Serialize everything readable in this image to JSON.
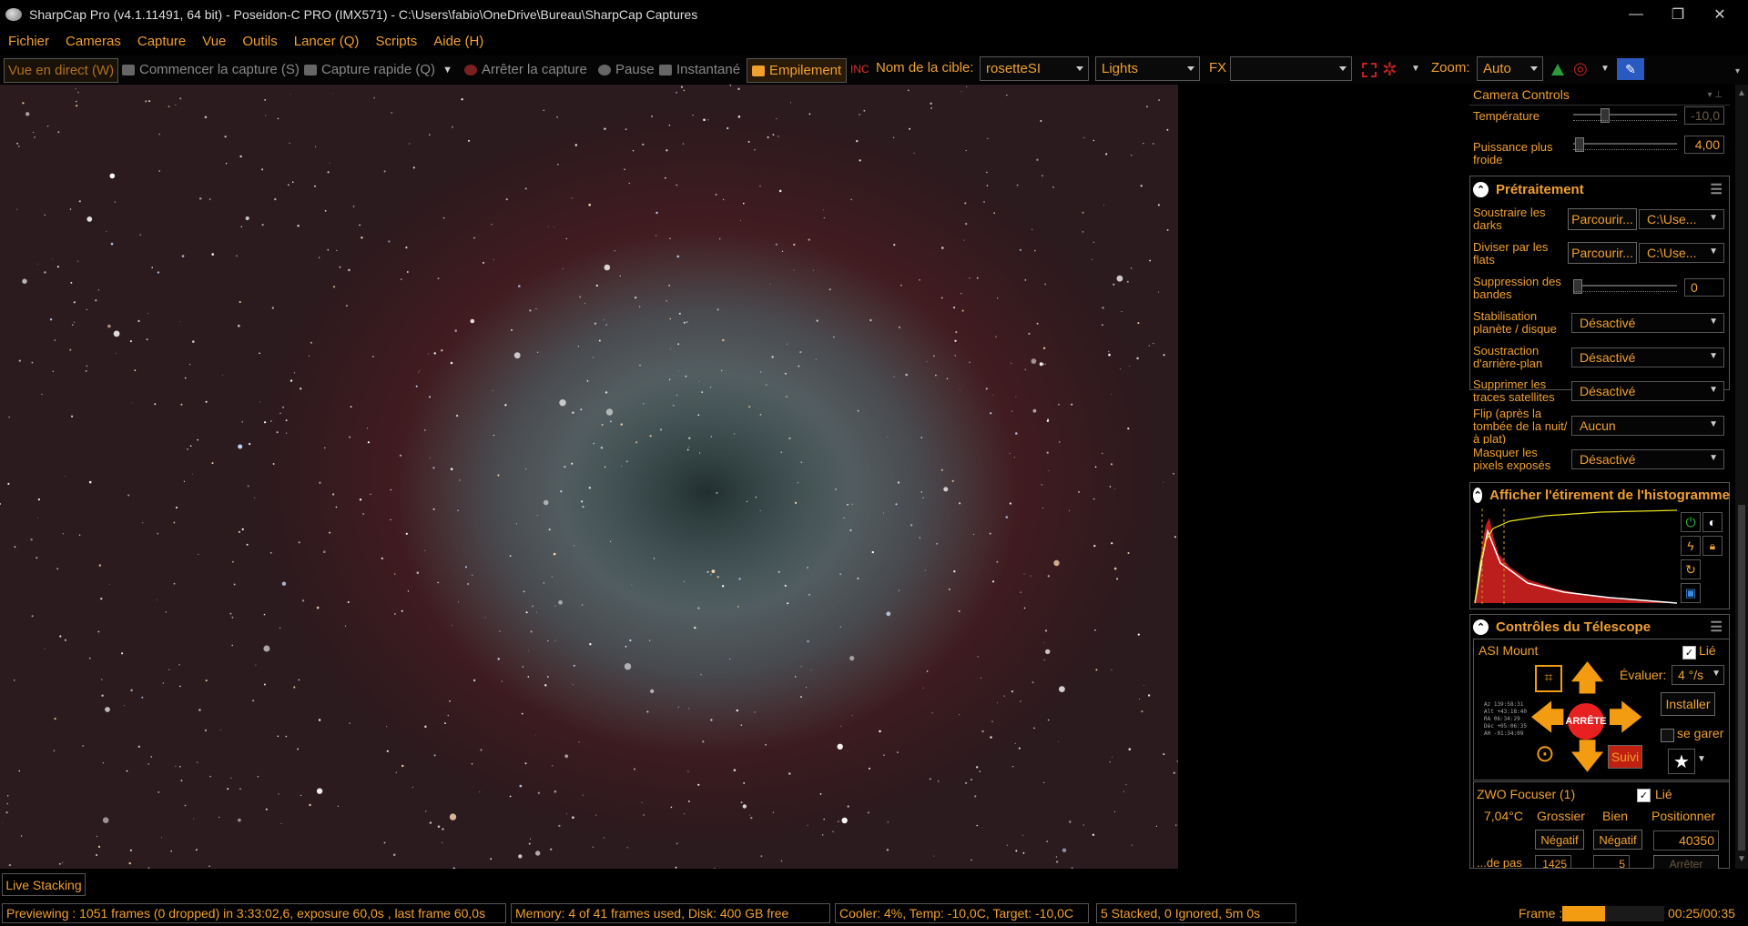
{
  "window": {
    "title": "SharpCap Pro (v4.1.11491, 64 bit) - Poseidon-C PRO (IMX571) - C:\\Users\\fabio\\OneDrive\\Bureau\\SharpCap Captures",
    "minimize": "—",
    "restore": "❐",
    "close": "✕"
  },
  "menu": [
    "Fichier",
    "Cameras",
    "Capture",
    "Vue",
    "Outils",
    "Lancer (Q)",
    "Scripts",
    "Aide (H)"
  ],
  "toolbar": {
    "live_view": "Vue en direct (W)",
    "start_capture": "Commencer la capture (S)",
    "quick_capture": "Capture rapide (Q)",
    "stop_capture": "Arrêter la capture",
    "pause": "Pause",
    "snapshot": "Instantané",
    "stacking": "Empilement",
    "target_label": "Nom de la cible:",
    "target_value": "rosetteSI",
    "frame_type": "Lights",
    "fx_label": "FX",
    "fx_value": "",
    "zoom_label": "Zoom:",
    "zoom_value": "Auto"
  },
  "panel": {
    "camera_controls_title": "Camera Controls",
    "temperature_label": "Température",
    "temperature_value": "-10,0",
    "cooler_power_label": "Puissance plus froide",
    "cooler_power_value": "4,00",
    "preprocessing": {
      "title": "Prétraitement",
      "darks_label": "Soustraire les darks",
      "darks_browse": "Parcourir...",
      "darks_path": "C:\\Use...",
      "flats_label": "Diviser par les flats",
      "flats_browse": "Parcourir...",
      "flats_path": "C:\\Use...",
      "banding_label": "Suppression des bandes",
      "banding_value": "0",
      "stabilization_label": "Stabilisation planète / disque",
      "stabilization_value": "Désactivé",
      "background_label": "Soustraction d'arrière-plan",
      "background_value": "Désactivé",
      "satellite_label": "Supprimer les traces satellites",
      "satellite_value": "Désactivé",
      "flip_label": "Flip (après la tombée de la nuit/à plat)",
      "flip_value": "Aucun",
      "hotpixels_label": "Masquer les pixels exposés",
      "hotpixels_value": "Désactivé"
    },
    "histogram": {
      "title": "Afficher l'étirement de l'histogramme"
    },
    "telescope": {
      "title": "Contrôles du Télescope",
      "mount_name": "ASI Mount",
      "linked_label": "Lié",
      "linked": true,
      "rate_label": "Évaluer:",
      "rate_value": "4 °/s",
      "stop_label": "ARRÊTE",
      "install_label": "Installer",
      "park_label": "se garer",
      "tracking_label": "Suivi",
      "coords": [
        "Az  139:58:31",
        "Alt +43:18:40",
        "RA   06:34:29",
        "Déc +05:06:35",
        "AH  -01:34:09"
      ]
    },
    "focuser": {
      "name": "ZWO Focuser (1)",
      "linked_label": "Lié",
      "linked": true,
      "temp": "7,04°C",
      "coarse_label": "Grossier",
      "fine_label": "Bien",
      "position_label": "Positionner",
      "coarse_neg": "Négatif",
      "fine_neg": "Négatif",
      "position_value": "40350",
      "step_label": "...de pas",
      "coarse_step": "1425",
      "fine_step": "5",
      "move_label": "Arrêter"
    }
  },
  "live_stacking_tab": "Live Stacking",
  "status": {
    "preview": "Previewing : 1051 frames (0 dropped) in 3:33:02,6, exposure 60,0s , last frame 60,0s",
    "memory": "Memory: 4 of 41 frames used, Disk: 400 GB free",
    "cooler": "Cooler: 4%, Temp: -10,0C, Target: -10,0C",
    "stacked": "5 Stacked, 0 Ignored, 5m 0s",
    "frame_label": "Frame :",
    "frame_progress": 0.42,
    "frame_time": "00:25/00:35"
  },
  "colors": {
    "accent": "#f0a030",
    "stop_red": "#e82020",
    "nebula_teal": "#6a9c9a",
    "nebula_red": "#8a2a2e"
  }
}
